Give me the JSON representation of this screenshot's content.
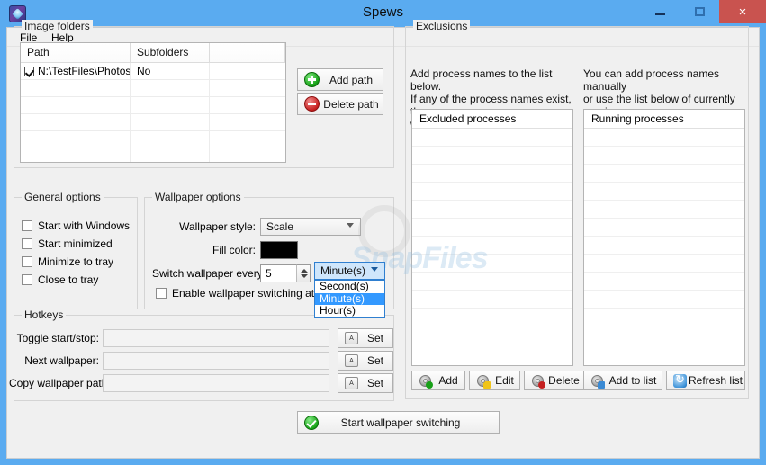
{
  "window": {
    "title": "Spews",
    "app_icon": "app-icon",
    "minimize": "minimize-icon",
    "maximize": "maximize-icon",
    "close": "×",
    "accent_color": "#5aabf0",
    "close_color": "#c9534f"
  },
  "menu": {
    "file": "File",
    "help": "Help"
  },
  "image_folders": {
    "group_label": "Image folders",
    "columns": [
      "Path",
      "Subfolders",
      ""
    ],
    "rows": [
      {
        "checked": true,
        "path": "N:\\TestFiles\\Photos",
        "subfolders": "No"
      }
    ],
    "empty_rows": 5,
    "add_button": "Add path",
    "delete_button": "Delete path"
  },
  "general_options": {
    "group_label": "General options",
    "items": [
      {
        "label": "Start with Windows",
        "checked": false
      },
      {
        "label": "Start minimized",
        "checked": false
      },
      {
        "label": "Minimize to tray",
        "checked": false
      },
      {
        "label": "Close to tray",
        "checked": false
      }
    ]
  },
  "wallpaper_options": {
    "group_label": "Wallpaper options",
    "style_label": "Wallpaper style:",
    "style_value": "Scale",
    "fill_color_label": "Fill color:",
    "fill_color_value": "#000000",
    "switch_label": "Switch wallpaper every:",
    "switch_value": "5",
    "unit_value": "Minute(s)",
    "unit_options": [
      "Second(s)",
      "Minute(s)",
      "Hour(s)"
    ],
    "unit_selected_index": 1,
    "enable_at_start_label": "Enable wallpaper switching at startup",
    "enable_at_start_checked": false
  },
  "hotkeys": {
    "group_label": "Hotkeys",
    "rows": [
      {
        "label": "Toggle start/stop:",
        "value": "",
        "button": "Set",
        "key_icon": "A"
      },
      {
        "label": "Next wallpaper:",
        "value": "",
        "button": "Set",
        "key_icon": "A"
      },
      {
        "label": "Copy wallpaper path:",
        "value": "",
        "button": "Set",
        "key_icon": "A"
      }
    ]
  },
  "start_button": {
    "label": "Start wallpaper switching",
    "icon": "green-check-icon"
  },
  "exclusions": {
    "group_label": "Exclusions",
    "description_left": "Add process names to the list below.\nIf any of the process names exist, the\nwallpaper will not be changed.",
    "description_right": "You can add process names manually\nor use the list below of currently\nrunning processes.",
    "excluded_header": "Excluded processes",
    "running_header": "Running processes",
    "excluded_items": [],
    "running_items": [],
    "buttons": {
      "add": "Add",
      "edit": "Edit",
      "delete": "Delete",
      "add_to_list": "Add to list",
      "refresh_list": "Refresh list"
    }
  },
  "watermark": {
    "text": "SnapFiles"
  }
}
